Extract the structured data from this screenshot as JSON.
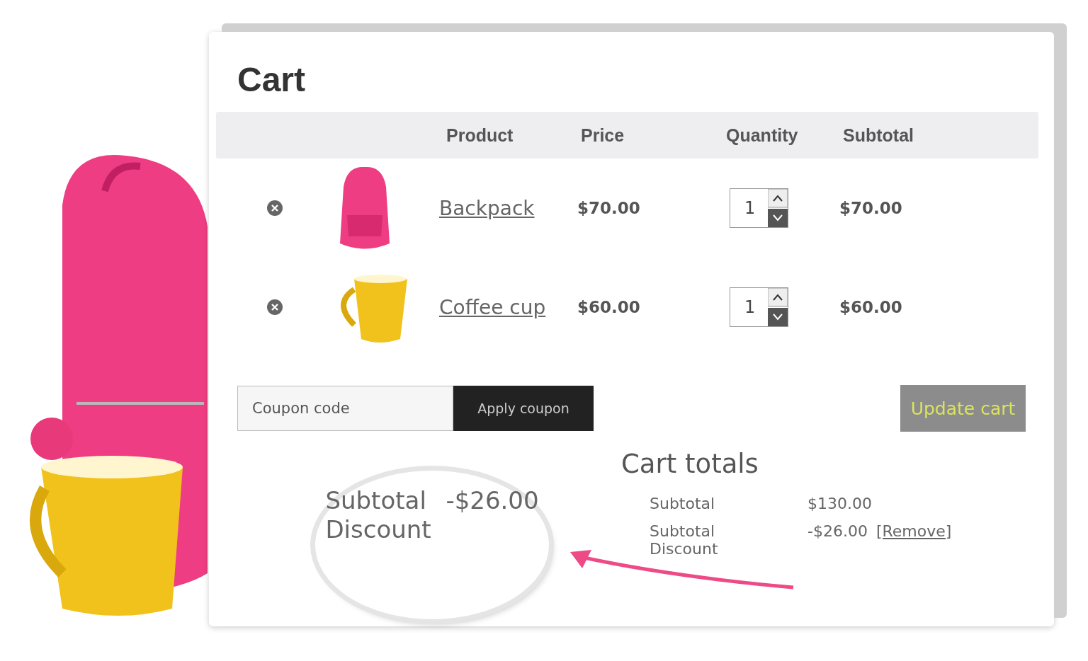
{
  "title": "Cart",
  "table": {
    "columns": [
      "Product",
      "Price",
      "Quantity",
      "Subtotal"
    ],
    "rows": [
      {
        "kind": "backpack",
        "product": "Backpack",
        "price": "$70.00",
        "quantity": "1",
        "subtotal": "$70.00"
      },
      {
        "kind": "cup",
        "product": "Coffee cup",
        "price": "$60.00",
        "quantity": "1",
        "subtotal": "$60.00"
      }
    ]
  },
  "coupon": {
    "placeholder": "Coupon code",
    "button": "Apply coupon"
  },
  "update_button": "Update cart",
  "totals": {
    "title": "Cart totals",
    "rows": [
      {
        "label": "Subtotal",
        "value": "$130.00"
      },
      {
        "label": "Subtotal Discount",
        "value": "-$26.00",
        "link": "[Remove]"
      }
    ]
  },
  "magnifier": {
    "label": "Subtotal Discount",
    "value": "-$26.00"
  }
}
